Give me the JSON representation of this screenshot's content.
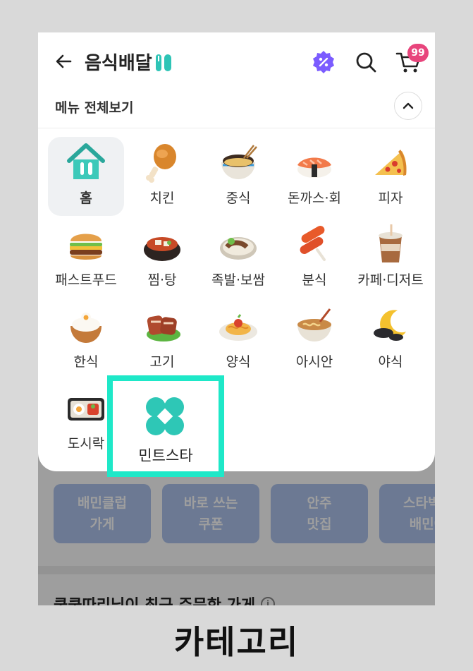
{
  "app": {
    "title": "음식배달"
  },
  "cart": {
    "badge": "99"
  },
  "menu": {
    "title": "메뉴 전체보기"
  },
  "categories": [
    {
      "label": "홈",
      "icon": "home-icon",
      "selected": true
    },
    {
      "label": "치킨",
      "icon": "chicken-icon"
    },
    {
      "label": "중식",
      "icon": "chinese-food-icon"
    },
    {
      "label": "돈까스·회",
      "icon": "sushi-icon"
    },
    {
      "label": "피자",
      "icon": "pizza-icon"
    },
    {
      "label": "패스트푸드",
      "icon": "burger-icon"
    },
    {
      "label": "찜·탕",
      "icon": "stew-icon"
    },
    {
      "label": "족발·보쌈",
      "icon": "jokbal-icon"
    },
    {
      "label": "분식",
      "icon": "tteokbokki-icon"
    },
    {
      "label": "카페·디저트",
      "icon": "coffee-icon"
    },
    {
      "label": "한식",
      "icon": "rice-bowl-icon"
    },
    {
      "label": "고기",
      "icon": "meat-icon"
    },
    {
      "label": "양식",
      "icon": "pasta-icon"
    },
    {
      "label": "아시안",
      "icon": "noodle-icon"
    },
    {
      "label": "야식",
      "icon": "moon-icon"
    },
    {
      "label": "도시락",
      "icon": "lunchbox-icon"
    }
  ],
  "highlight": {
    "label": "민트스타",
    "icon": "mint-star-icon",
    "border_color": "#1ee8c8"
  },
  "background": {
    "promos": [
      "배민클럽\n가게",
      "바로 쓰는\n쿠폰",
      "안주\n맛집",
      "스타벅스\n배민에"
    ],
    "recent_orders_title": "쿵쿵따리님이 최근 주문한 가게",
    "info_icon": "i"
  },
  "caption": "카테고리",
  "colors": {
    "accent_purple": "#7b5cff",
    "badge_pink": "#e8457c",
    "mint": "#1ee8c8"
  }
}
